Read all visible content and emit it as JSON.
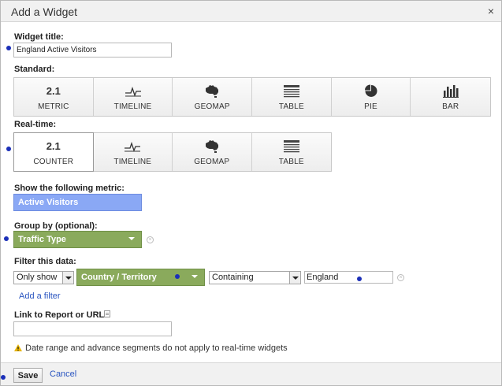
{
  "dialog": {
    "title": "Add a Widget",
    "close_glyph": "×"
  },
  "widget_title": {
    "label": "Widget title:",
    "value": "England Active Visitors"
  },
  "standard": {
    "label": "Standard:",
    "tiles": [
      {
        "num": "2.1",
        "label": "METRIC",
        "icon": "number-icon"
      },
      {
        "label": "TIMELINE",
        "icon": "timeline-icon"
      },
      {
        "label": "GEOMAP",
        "icon": "map-icon"
      },
      {
        "label": "TABLE",
        "icon": "table-icon"
      },
      {
        "label": "PIE",
        "icon": "pie-icon"
      },
      {
        "label": "BAR",
        "icon": "bar-icon"
      }
    ]
  },
  "realtime": {
    "label": "Real-time:",
    "selected": "COUNTER",
    "tiles": [
      {
        "num": "2.1",
        "label": "COUNTER",
        "icon": "number-icon"
      },
      {
        "label": "TIMELINE",
        "icon": "timeline-icon"
      },
      {
        "label": "GEOMAP",
        "icon": "map-icon"
      },
      {
        "label": "TABLE",
        "icon": "table-icon"
      }
    ]
  },
  "metric": {
    "label": "Show the following metric:",
    "value": "Active Visitors"
  },
  "group_by": {
    "label": "Group by (optional):",
    "value": "Traffic Type"
  },
  "filter": {
    "label": "Filter this data:",
    "mode": "Only show",
    "dimension": "Country / Territory",
    "operator": "Containing",
    "value": "England",
    "add_filter": "Add a filter"
  },
  "link": {
    "label": "Link to Report or URL:",
    "value": ""
  },
  "warning": "Date range and advance segments do not apply to real-time widgets",
  "footer": {
    "save": "Save",
    "cancel": "Cancel"
  },
  "colors": {
    "metric_blue": "#8aa8f5",
    "dimension_green": "#8aaa5c",
    "link_blue": "#2a55c0",
    "marker_blue": "#1b2fb8"
  }
}
